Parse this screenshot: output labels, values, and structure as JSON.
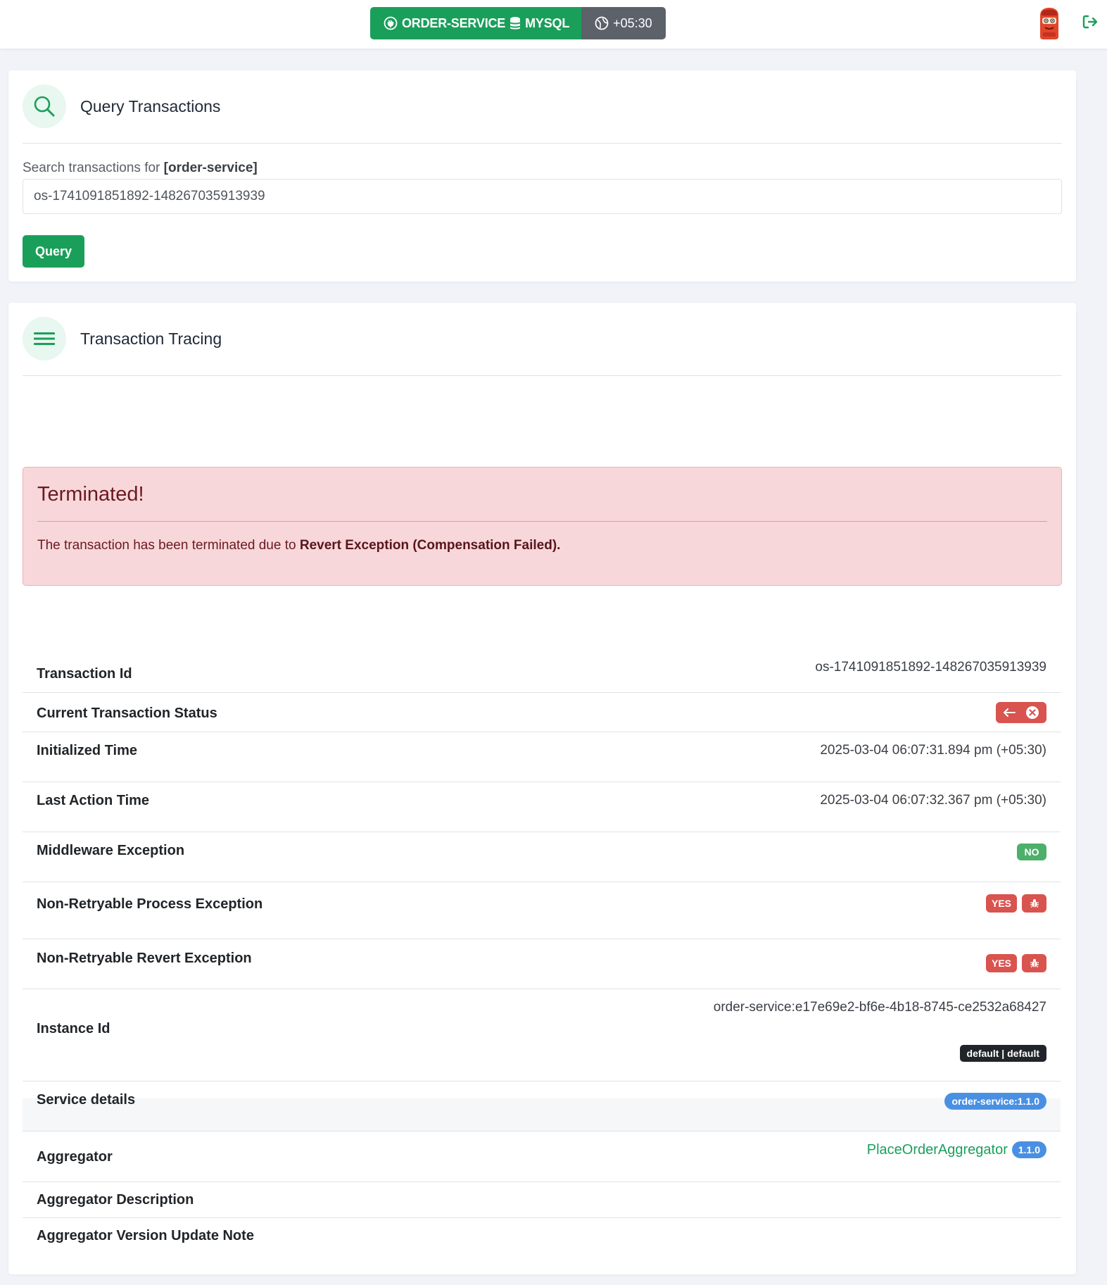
{
  "header": {
    "service": "ORDER-SERVICE",
    "database": "MYSQL",
    "timezone": "+05:30"
  },
  "query_card": {
    "title": "Query Transactions",
    "label_prefix": "Search transactions for",
    "label_service": "[order-service]",
    "search_value": "os-1741091851892-148267035913939",
    "button_label": "Query"
  },
  "tracing_card": {
    "title": "Transaction Tracing",
    "alert": {
      "title": "Terminated!",
      "text_prefix": "The transaction has been terminated due to",
      "text_bold": "Revert Exception (Compensation Failed)."
    },
    "details": {
      "transaction_id_label": "Transaction Id",
      "transaction_id": "os-1741091851892-148267035913939",
      "status_label": "Current Transaction Status",
      "initialized_label": "Initialized Time",
      "initialized_time": "2025-03-04 06:07:31.894 pm (+05:30)",
      "last_action_label": "Last Action Time",
      "last_action_time": "2025-03-04 06:07:32.367 pm (+05:30)",
      "middleware_label": "Middleware Exception",
      "middleware_value": "NO",
      "nr_process_label": "Non-Retryable Process Exception",
      "nr_process_value": "YES",
      "nr_revert_label": "Non-Retryable Revert Exception",
      "nr_revert_value": "YES",
      "instance_label": "Instance Id",
      "instance_id": "order-service:e17e69e2-bf6e-4b18-8745-ce2532a68427",
      "instance_badge": "default | default",
      "service_label": "Service details",
      "service_badge": "order-service:1.1.0",
      "aggregator_label": "Aggregator",
      "aggregator_name": "PlaceOrderAggregator",
      "aggregator_version": "1.1.0",
      "aggregator_desc_label": "Aggregator Description",
      "aggregator_note_label": "Aggregator Version Update Note"
    }
  },
  "colors": {
    "brand": "#1a9f5a",
    "danger": "#d9534f",
    "success_badge": "#4caf6a",
    "info_badge": "#4a90e2"
  }
}
